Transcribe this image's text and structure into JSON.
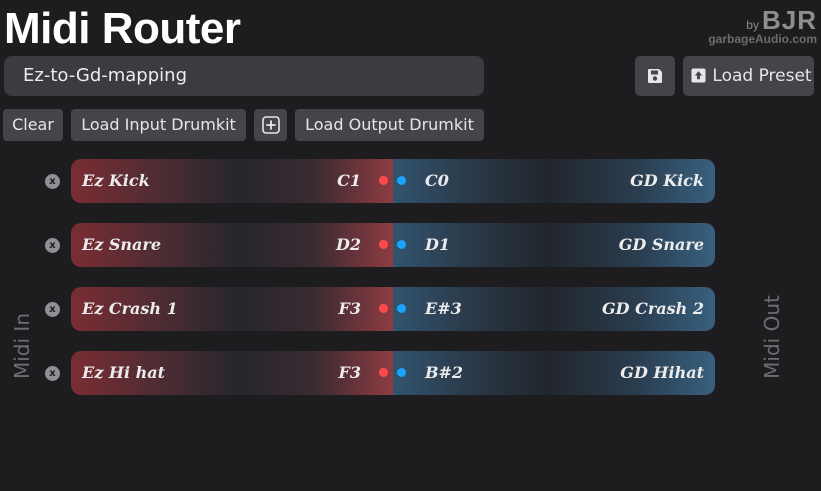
{
  "app": {
    "title": "Midi Router"
  },
  "brand": {
    "by": "by",
    "name": "BJR",
    "site": "garbageAudio.com"
  },
  "preset": {
    "name": "Ez-to-Gd-mapping"
  },
  "toolbar": {
    "load_preset": "Load Preset",
    "clear": "Clear",
    "load_input_drumkit": "Load Input Drumkit",
    "load_output_drumkit": "Load Output Drumkit"
  },
  "labels": {
    "midi_in": "Midi In",
    "midi_out": "Midi Out"
  },
  "mappings": [
    {
      "remove": "x",
      "in_name": "Ez Kick",
      "in_note": "C1",
      "out_note": "C0",
      "out_name": "GD Kick"
    },
    {
      "remove": "x",
      "in_name": "Ez Snare",
      "in_note": "D2",
      "out_note": "D1",
      "out_name": "GD Snare"
    },
    {
      "remove": "x",
      "in_name": "Ez Crash 1",
      "in_note": "F3",
      "out_note": "E#3",
      "out_name": "GD Crash 2"
    },
    {
      "remove": "x",
      "in_name": "Ez Hi hat",
      "in_note": "F3",
      "out_note": "B#2",
      "out_name": "GD Hihat"
    }
  ],
  "colors": {
    "input_accent": "#ff4a4a",
    "output_accent": "#1aa3ff",
    "background": "#1d1d20"
  },
  "icons": {
    "save": "save-icon",
    "load_preset": "upload-icon",
    "add": "plus-square-icon",
    "remove": "close-icon"
  }
}
